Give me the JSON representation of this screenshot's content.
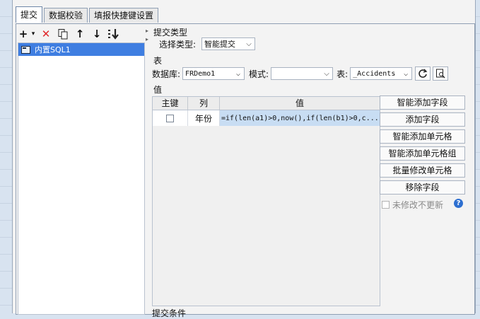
{
  "tabs": [
    "提交",
    "数据校验",
    "填报快捷键设置"
  ],
  "left": {
    "toolbar": [
      "+",
      "▾",
      "✕",
      "copy",
      "↑",
      "↓",
      "reorder"
    ],
    "tree_item": "内置SQL1"
  },
  "submit_type": {
    "section": "提交类型",
    "label": "选择类型:",
    "value": "智能提交"
  },
  "table": {
    "section": "表",
    "db_label": "数据库:",
    "db_value": "FRDemo1",
    "schema_label": "模式:",
    "schema_value": "",
    "table_label": "表:",
    "table_value": "_Accidents"
  },
  "values": {
    "section": "值",
    "headers": [
      "主键",
      "列",
      "值"
    ],
    "rows": [
      {
        "column": "年份",
        "value": "=if(len(a1)>0,now(),if(len(b1)>0,c..."
      }
    ]
  },
  "buttons": [
    "智能添加字段",
    "添加字段",
    "智能添加单元格",
    "智能添加单元格组",
    "批量修改单元格",
    "移除字段"
  ],
  "not_modified_label": "未修改不更新",
  "help": "?",
  "bottom_section": "提交条件"
}
